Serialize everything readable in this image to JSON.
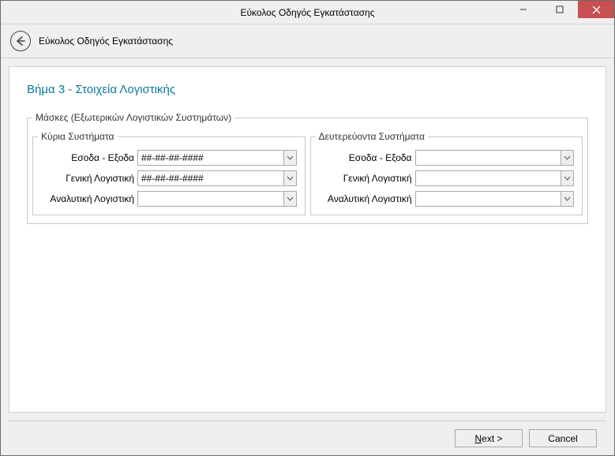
{
  "window": {
    "title": "Εύκολος Οδηγός Εγκατάστασης"
  },
  "header": {
    "subtitle": "Εύκολος Οδηγός Εγκατάστασης"
  },
  "step": {
    "title": "Βήμα 3 - Στοιχεία Λογιστικής"
  },
  "masks": {
    "legend": "Μάσκες (Εξωτερικών Λογιστικών Συστημάτων)",
    "primary": {
      "legend": "Κύρια Συστήματα",
      "fields": {
        "income_expense": {
          "label": "Εσοδα - Εξοδα",
          "value": "##-##-##-####"
        },
        "general_accounting": {
          "label": "Γενική Λογιστική",
          "value": "##-##-##-####"
        },
        "analytical_accounting": {
          "label": "Αναλυτική Λογιστική",
          "value": ""
        }
      }
    },
    "secondary": {
      "legend": "Δευτερεύοντα Συστήματα",
      "fields": {
        "income_expense": {
          "label": "Εσοδα - Εξοδα",
          "value": ""
        },
        "general_accounting": {
          "label": "Γενική Λογιστική",
          "value": ""
        },
        "analytical_accounting": {
          "label": "Αναλυτική Λογιστική",
          "value": ""
        }
      }
    }
  },
  "footer": {
    "next_prefix": "N",
    "next_suffix": "ext >",
    "cancel": "Cancel"
  }
}
